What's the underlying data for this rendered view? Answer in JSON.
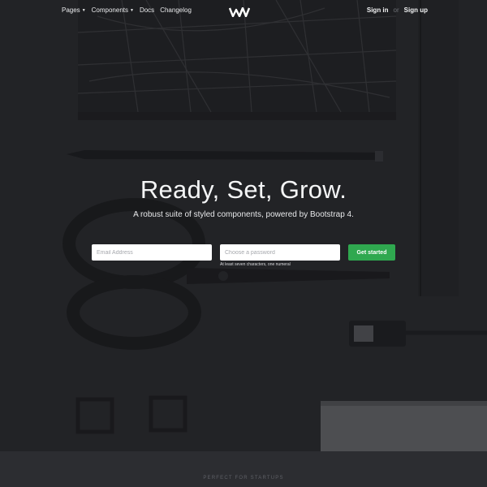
{
  "nav": {
    "items": [
      {
        "label": "Pages",
        "has_dropdown": true
      },
      {
        "label": "Components",
        "has_dropdown": true
      },
      {
        "label": "Docs",
        "has_dropdown": false
      },
      {
        "label": "Changelog",
        "has_dropdown": false
      }
    ],
    "logo_icon": "wingman-logo-icon",
    "sign_in": "Sign in",
    "separator": "or",
    "sign_up": "Sign up"
  },
  "hero": {
    "title": "Ready, Set, Grow.",
    "subtitle": "A robust suite of styled components, powered by Bootstrap 4.",
    "email_placeholder": "Email Address",
    "password_placeholder": "Choose a password",
    "password_hint": "At least seven characters, one numeral",
    "cta": "Get started"
  },
  "footer": {
    "label": "PERFECT FOR STARTUPS"
  },
  "colors": {
    "background": "#2b2c2f",
    "accent": "#2fa84f",
    "text": "#f4f5f6"
  }
}
